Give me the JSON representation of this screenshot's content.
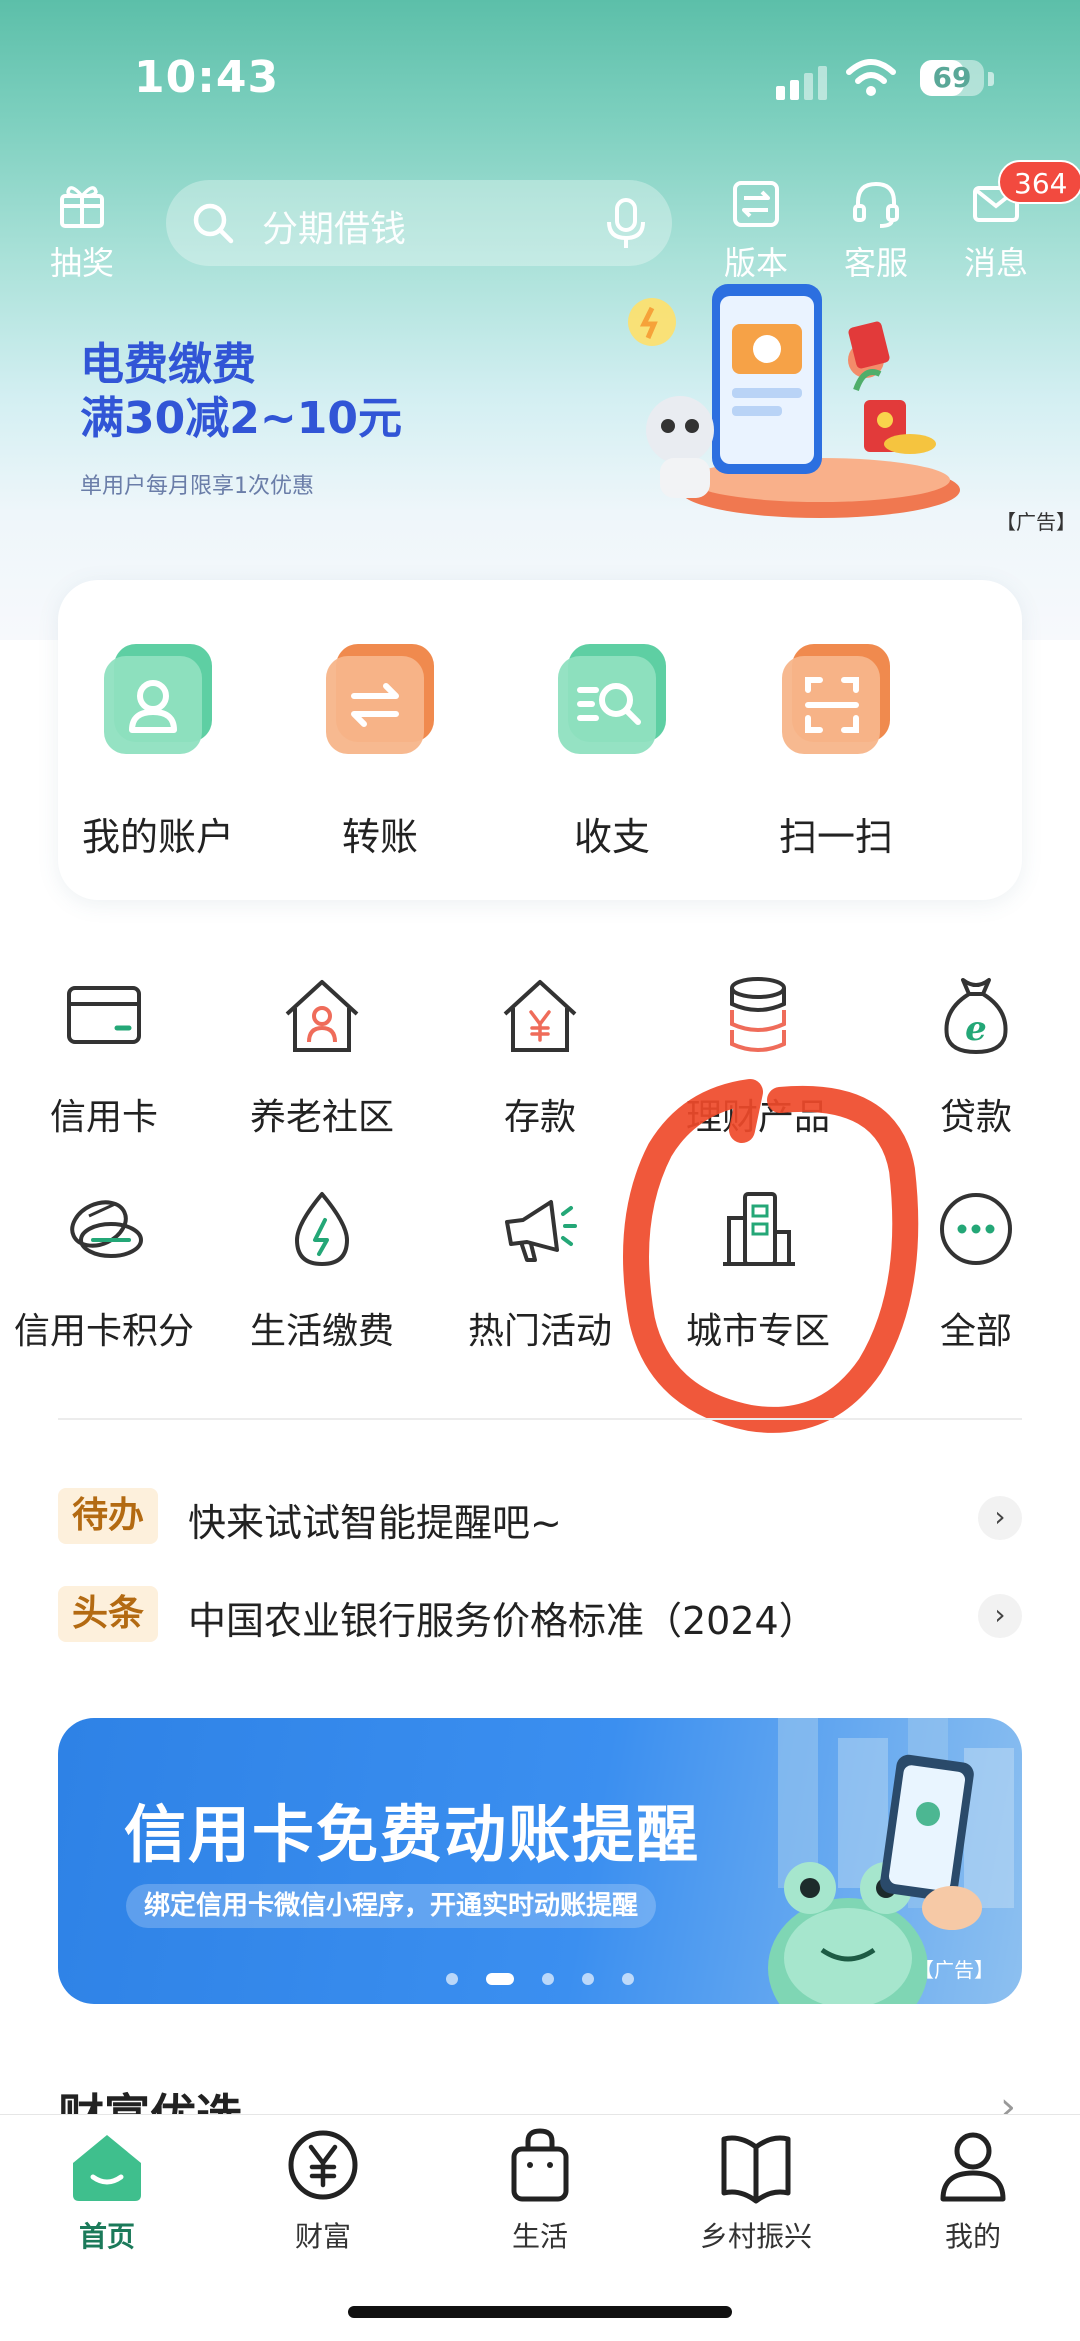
{
  "status_bar": {
    "time": "10:43",
    "battery": "69",
    "battery_level": 0.69
  },
  "header": {
    "lottery_label": "抽奖",
    "search_placeholder": "分期借钱",
    "version_label": "版本",
    "service_label": "客服",
    "message_label": "消息",
    "message_badge": "364"
  },
  "promo": {
    "line1": "电费缴费",
    "line2": "满30减2~10元",
    "subtitle": "单用户每月限享1次优惠",
    "ad_tag": "【广告】"
  },
  "main_actions": [
    {
      "label": "我的账户",
      "icon": "account-icon"
    },
    {
      "label": "转账",
      "icon": "transfer-icon"
    },
    {
      "label": "收支",
      "icon": "income-expense-icon"
    },
    {
      "label": "扫一扫",
      "icon": "scan-icon"
    }
  ],
  "grid": [
    {
      "label": "信用卡",
      "icon": "credit-card-icon"
    },
    {
      "label": "养老社区",
      "icon": "elderly-community-icon"
    },
    {
      "label": "存款",
      "icon": "deposit-icon"
    },
    {
      "label": "理财产品",
      "icon": "wealth-product-icon"
    },
    {
      "label": "贷款",
      "icon": "loan-icon"
    },
    {
      "label": "信用卡积分",
      "icon": "card-points-icon"
    },
    {
      "label": "生活缴费",
      "icon": "utility-payment-icon"
    },
    {
      "label": "热门活动",
      "icon": "hot-activity-icon"
    },
    {
      "label": "城市专区",
      "icon": "city-zone-icon"
    },
    {
      "label": "全部",
      "icon": "more-icon"
    }
  ],
  "notices": [
    {
      "tag": "待办",
      "text": "快来试试智能提醒吧~"
    },
    {
      "tag": "头条",
      "text": "中国农业银行服务价格标准（2024）"
    }
  ],
  "credit_banner": {
    "title": "信用卡免费动账提醒",
    "subtitle": "绑定信用卡微信小程序，开通实时动账提醒",
    "ad_tag": "【广告】",
    "page_count": 5,
    "current_page": 2
  },
  "section": {
    "title": "财富优选"
  },
  "tabbar": [
    {
      "label": "首页",
      "icon": "home-icon",
      "active": true
    },
    {
      "label": "财富",
      "icon": "wealth-icon",
      "active": false
    },
    {
      "label": "生活",
      "icon": "shopping-bag-icon",
      "active": false
    },
    {
      "label": "乡村振兴",
      "icon": "rural-book-icon",
      "active": false
    },
    {
      "label": "我的",
      "icon": "profile-icon",
      "active": false
    }
  ],
  "colors": {
    "brand_green": "#1b7a5a",
    "promo_blue": "#3155d6",
    "badge_red": "#f24a3f",
    "annotation_red": "#ef4a2a"
  }
}
